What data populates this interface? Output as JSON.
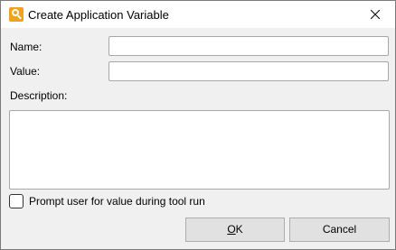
{
  "window": {
    "title": "Create Application Variable",
    "icon": "app-logo-icon",
    "close_icon": "close-icon"
  },
  "form": {
    "name": {
      "label": "Name:",
      "value": ""
    },
    "value": {
      "label": "Value:",
      "value": ""
    },
    "description": {
      "label": "Description:",
      "value": ""
    },
    "prompt_checkbox": {
      "label": "Prompt user for value during tool run",
      "checked": false
    }
  },
  "buttons": {
    "ok": {
      "label_mnemonic": "O",
      "label_rest": "K"
    },
    "cancel": {
      "label": "Cancel"
    }
  },
  "colors": {
    "accent_icon": "#f0a11d",
    "dialog_bg": "#f0f0f0",
    "button_bg": "#e1e1e1"
  }
}
